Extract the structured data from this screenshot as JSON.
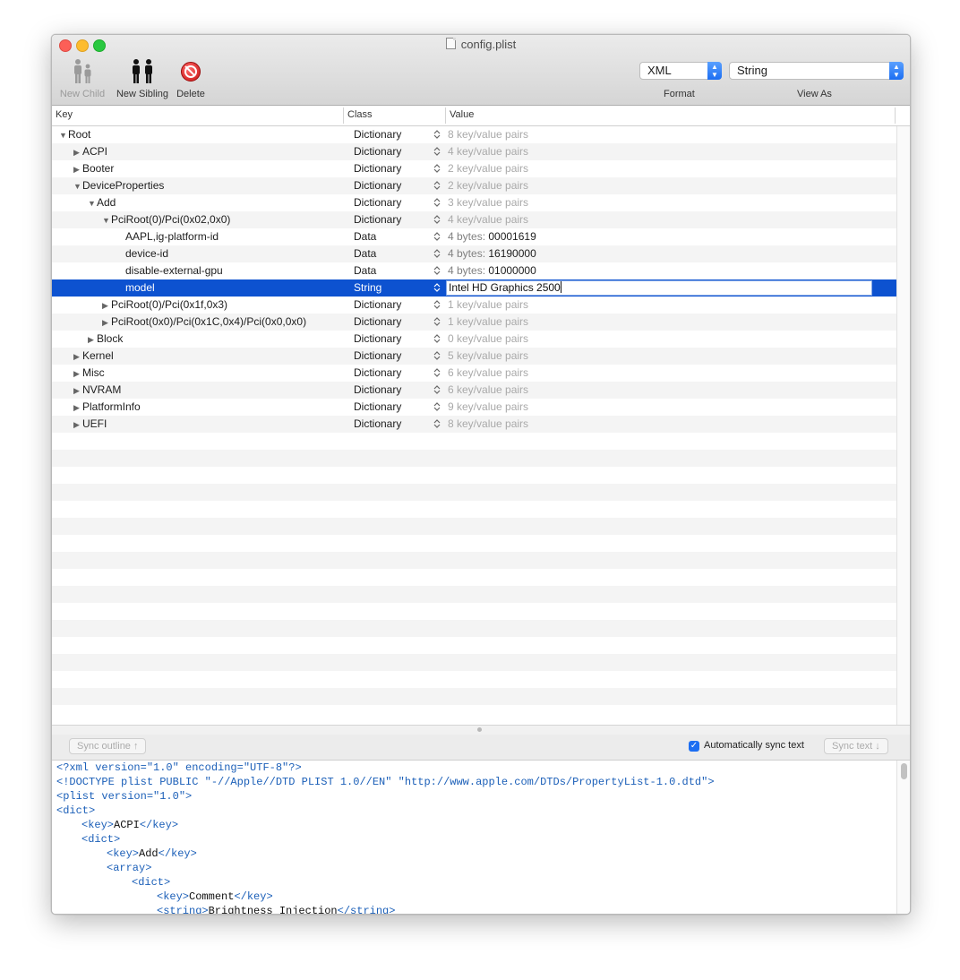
{
  "window": {
    "title": "config.plist"
  },
  "toolbar": {
    "new_child": "New Child",
    "new_sibling": "New Sibling",
    "delete": "Delete",
    "format_value": "XML",
    "format_label": "Format",
    "view_as_value": "String",
    "view_as_label": "View As"
  },
  "columns": {
    "key": "Key",
    "class": "Class",
    "value": "Value"
  },
  "rows": [
    {
      "key": "Root",
      "class": "Dictionary",
      "value": "8 key/value pairs",
      "indent": 0,
      "tri": "▼",
      "kind": "gray"
    },
    {
      "key": "ACPI",
      "class": "Dictionary",
      "value": "4 key/value pairs",
      "indent": 1,
      "tri": "▶",
      "kind": "gray"
    },
    {
      "key": "Booter",
      "class": "Dictionary",
      "value": "2 key/value pairs",
      "indent": 1,
      "tri": "▶",
      "kind": "gray"
    },
    {
      "key": "DeviceProperties",
      "class": "Dictionary",
      "value": "2 key/value pairs",
      "indent": 1,
      "tri": "▼",
      "kind": "gray"
    },
    {
      "key": "Add",
      "class": "Dictionary",
      "value": "3 key/value pairs",
      "indent": 2,
      "tri": "▼",
      "kind": "gray"
    },
    {
      "key": "PciRoot(0)/Pci(0x02,0x0)",
      "class": "Dictionary",
      "value": "4 key/value pairs",
      "indent": 3,
      "tri": "▼",
      "kind": "gray"
    },
    {
      "key": "AAPL,ig-platform-id",
      "class": "Data",
      "value_prefix": "4 bytes: ",
      "value": "00001619",
      "indent": 4,
      "tri": "",
      "kind": "data"
    },
    {
      "key": "device-id",
      "class": "Data",
      "value_prefix": "4 bytes: ",
      "value": "16190000",
      "indent": 4,
      "tri": "",
      "kind": "data"
    },
    {
      "key": "disable-external-gpu",
      "class": "Data",
      "value_prefix": "4 bytes: ",
      "value": "01000000",
      "indent": 4,
      "tri": "",
      "kind": "data"
    },
    {
      "key": "model",
      "class": "String",
      "value": "Intel HD Graphics 2500",
      "indent": 4,
      "tri": "",
      "kind": "edit"
    },
    {
      "key": "PciRoot(0)/Pci(0x1f,0x3)",
      "class": "Dictionary",
      "value": "1 key/value pairs",
      "indent": 3,
      "tri": "▶",
      "kind": "gray"
    },
    {
      "key": "PciRoot(0x0)/Pci(0x1C,0x4)/Pci(0x0,0x0)",
      "class": "Dictionary",
      "value": "1 key/value pairs",
      "indent": 3,
      "tri": "▶",
      "kind": "gray"
    },
    {
      "key": "Block",
      "class": "Dictionary",
      "value": "0 key/value pairs",
      "indent": 2,
      "tri": "▶",
      "kind": "gray"
    },
    {
      "key": "Kernel",
      "class": "Dictionary",
      "value": "5 key/value pairs",
      "indent": 1,
      "tri": "▶",
      "kind": "gray"
    },
    {
      "key": "Misc",
      "class": "Dictionary",
      "value": "6 key/value pairs",
      "indent": 1,
      "tri": "▶",
      "kind": "gray"
    },
    {
      "key": "NVRAM",
      "class": "Dictionary",
      "value": "6 key/value pairs",
      "indent": 1,
      "tri": "▶",
      "kind": "gray"
    },
    {
      "key": "PlatformInfo",
      "class": "Dictionary",
      "value": "9 key/value pairs",
      "indent": 1,
      "tri": "▶",
      "kind": "gray"
    },
    {
      "key": "UEFI",
      "class": "Dictionary",
      "value": "8 key/value pairs",
      "indent": 1,
      "tri": "▶",
      "kind": "gray"
    }
  ],
  "bottom_bar": {
    "sync_outline": "Sync outline ↑",
    "auto_sync_checked": true,
    "auto_sync_label": "Automatically sync text",
    "sync_text": "Sync text ↓"
  },
  "xml_lines": [
    {
      "indent": 0,
      "parts": [
        {
          "t": "tag",
          "s": "<?xml version=\"1.0\" encoding=\"UTF-8\"?>"
        }
      ]
    },
    {
      "indent": 0,
      "parts": [
        {
          "t": "tag",
          "s": "<!DOCTYPE plist PUBLIC \"-//Apple//DTD PLIST 1.0//EN\" \"http://www.apple.com/DTDs/PropertyList-1.0.dtd\">"
        }
      ]
    },
    {
      "indent": 0,
      "parts": [
        {
          "t": "tag",
          "s": "<plist version=\"1.0\">"
        }
      ]
    },
    {
      "indent": 0,
      "parts": [
        {
          "t": "tag",
          "s": "<dict>"
        }
      ]
    },
    {
      "indent": 1,
      "parts": [
        {
          "t": "tag",
          "s": "<key>"
        },
        {
          "t": "txt",
          "s": "ACPI"
        },
        {
          "t": "tag",
          "s": "</key>"
        }
      ]
    },
    {
      "indent": 1,
      "parts": [
        {
          "t": "tag",
          "s": "<dict>"
        }
      ]
    },
    {
      "indent": 2,
      "parts": [
        {
          "t": "tag",
          "s": "<key>"
        },
        {
          "t": "txt",
          "s": "Add"
        },
        {
          "t": "tag",
          "s": "</key>"
        }
      ]
    },
    {
      "indent": 2,
      "parts": [
        {
          "t": "tag",
          "s": "<array>"
        }
      ]
    },
    {
      "indent": 3,
      "parts": [
        {
          "t": "tag",
          "s": "<dict>"
        }
      ]
    },
    {
      "indent": 4,
      "parts": [
        {
          "t": "tag",
          "s": "<key>"
        },
        {
          "t": "txt",
          "s": "Comment"
        },
        {
          "t": "tag",
          "s": "</key>"
        }
      ]
    },
    {
      "indent": 4,
      "parts": [
        {
          "t": "tag",
          "s": "<string>"
        },
        {
          "t": "txt",
          "s": "Brightness Injection"
        },
        {
          "t": "tag",
          "s": "</string>"
        }
      ]
    }
  ],
  "colors": {
    "selection": "#0d52d0",
    "accent": "#1c6ef2",
    "xml_tag": "#1b5fb8"
  },
  "icons": {
    "new_child": "people-icon",
    "new_sibling": "people-icon",
    "delete": "delete-icon"
  }
}
